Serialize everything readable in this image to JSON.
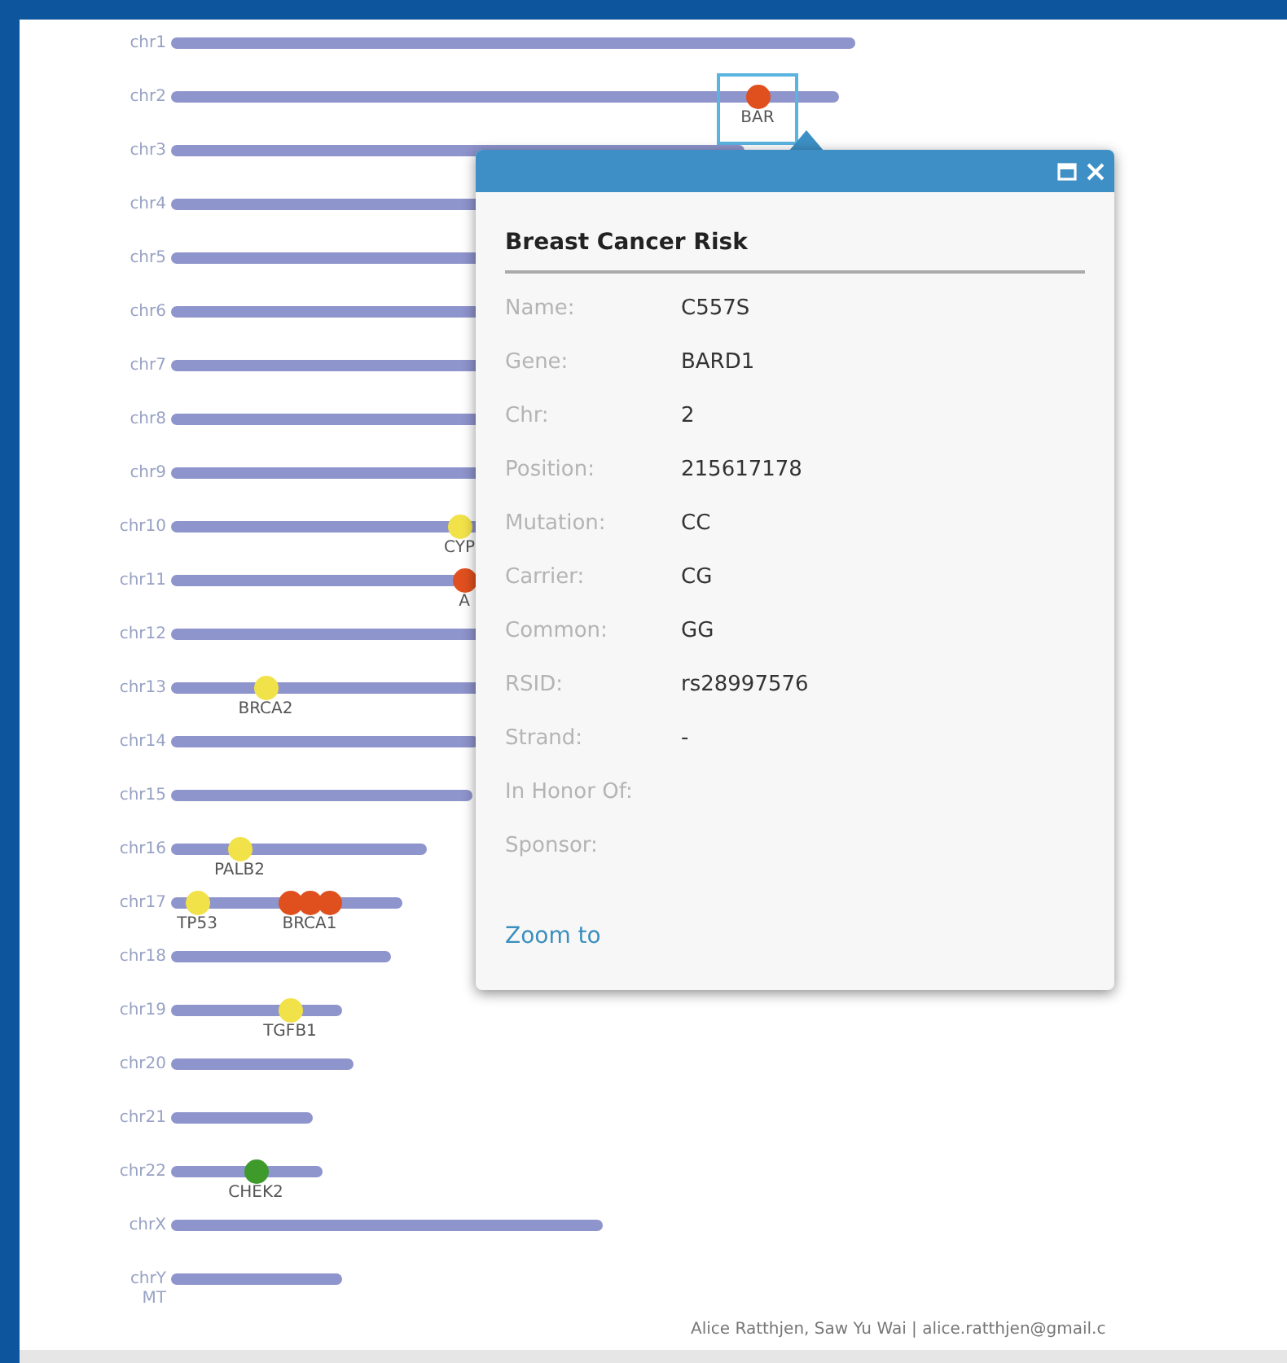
{
  "chromosomes": [
    {
      "name": "chr1"
    },
    {
      "name": "chr2",
      "markers": [
        {
          "color": "#e0501e",
          "label": "BAR",
          "selected": true
        }
      ]
    },
    {
      "name": "chr3"
    },
    {
      "name": "chr4"
    },
    {
      "name": "chr5"
    },
    {
      "name": "chr6"
    },
    {
      "name": "chr7"
    },
    {
      "name": "chr8"
    },
    {
      "name": "chr9"
    },
    {
      "name": "chr10",
      "markers": [
        {
          "color": "#f2e24a",
          "label": "CYP",
          "selected": false
        }
      ]
    },
    {
      "name": "chr11",
      "markers": [
        {
          "color": "#e0501e",
          "label": "A",
          "selected": false
        }
      ]
    },
    {
      "name": "chr12"
    },
    {
      "name": "chr13",
      "markers": [
        {
          "color": "#f2e24a",
          "label": "BRCA2",
          "selected": false
        }
      ]
    },
    {
      "name": "chr14"
    },
    {
      "name": "chr15"
    },
    {
      "name": "chr16",
      "markers": [
        {
          "color": "#f2e24a",
          "label": "PALB2",
          "selected": false
        }
      ]
    },
    {
      "name": "chr17",
      "markers": [
        {
          "color": "#f2e24a",
          "label": "TP53",
          "selected": false
        },
        {
          "color": "#e0501e",
          "selected": false
        },
        {
          "color": "#e0501e",
          "label": "BRCA1",
          "selected": false
        },
        {
          "color": "#e0501e",
          "selected": false
        }
      ]
    },
    {
      "name": "chr18"
    },
    {
      "name": "chr19",
      "markers": [
        {
          "color": "#f2e24a",
          "label": "TGFB1",
          "selected": false
        }
      ]
    },
    {
      "name": "chr20"
    },
    {
      "name": "chr21"
    },
    {
      "name": "chr22",
      "markers": [
        {
          "color": "#3f9a2c",
          "label": "CHEK2",
          "selected": false
        }
      ]
    },
    {
      "name": "chrX"
    },
    {
      "name": "chrY",
      "sub": "MT"
    }
  ],
  "popup": {
    "title": "Breast Cancer Risk",
    "fields": [
      {
        "label": "Name:",
        "value": "C557S"
      },
      {
        "label": "Gene:",
        "value": "BARD1"
      },
      {
        "label": "Chr:",
        "value": "2"
      },
      {
        "label": "Position:",
        "value": "215617178"
      },
      {
        "label": "Mutation:",
        "value": "CC"
      },
      {
        "label": "Carrier:",
        "value": "CG"
      },
      {
        "label": "Common:",
        "value": "GG"
      },
      {
        "label": "RSID:",
        "value": "rs28997576"
      },
      {
        "label": "Strand:",
        "value": "-"
      },
      {
        "label": "In Honor Of:"
      },
      {
        "label": "Sponsor:"
      }
    ],
    "link": "Zoom to"
  },
  "footer": "Alice Ratthjen, Saw Yu Wai | alice.ratthjen@gmail.c"
}
